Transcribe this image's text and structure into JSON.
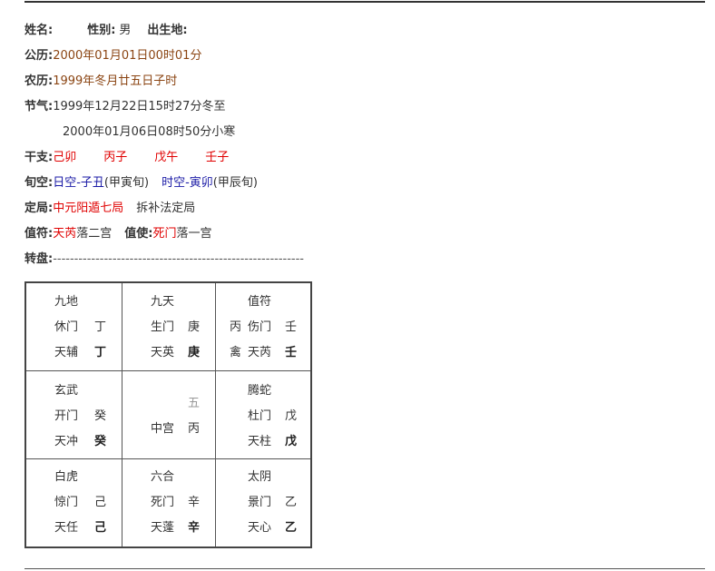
{
  "header": {
    "name_label": "姓名:",
    "gender_label": "性别:",
    "gender_value": "男",
    "birthplace_label": "出生地:"
  },
  "solar": {
    "label": "公历:",
    "value": "2000年01月01日00时01分"
  },
  "lunar": {
    "label": "农历:",
    "value": "1999年冬月廿五日子时"
  },
  "solar_terms": {
    "label": "节气:",
    "items": [
      "1999年12月22日15时27分冬至",
      "2000年01月06日08时50分小寒"
    ]
  },
  "ganzhi": {
    "label": "干支:",
    "items": [
      "己卯",
      "丙子",
      "戊午",
      "壬子"
    ]
  },
  "xunkong": {
    "label": "旬空:",
    "day_void": "日空-子丑",
    "day_xun": "(甲寅旬)",
    "hour_void": "时空-寅卯",
    "hour_xun": "(甲辰旬)"
  },
  "ju": {
    "label": "定局:",
    "value": "中元阳遁七局",
    "method": "拆补法定局"
  },
  "zhifu": {
    "label": "值符:",
    "star": "天芮",
    "star_palace": "落二宫",
    "shi_label": "值使:",
    "door": "死门",
    "door_palace": "落一宫"
  },
  "zhuanpan": {
    "label": "转盘:",
    "rule": "-----------------------------------------------------------"
  },
  "palaces": [
    {
      "god": "九地",
      "door": "休门",
      "sky_stem": "丁",
      "star": "天辅",
      "earth_stem": "丁"
    },
    {
      "god": "九天",
      "door": "生门",
      "sky_stem": "庚",
      "star": "天英",
      "earth_stem": "庚"
    },
    {
      "god": "值符",
      "hidden_left_door": "丙",
      "door": "伤门",
      "sky_stem": "壬",
      "hidden_left_star": "禽",
      "star": "天芮",
      "earth_stem": "壬"
    },
    {
      "god": "玄武",
      "door": "开门",
      "sky_stem": "癸",
      "star": "天冲",
      "earth_stem": "癸"
    },
    {
      "center_num": "五",
      "center_label": "中宫",
      "center_stem": "丙"
    },
    {
      "god": "腾蛇",
      "door": "杜门",
      "sky_stem": "戊",
      "star": "天柱",
      "earth_stem": "戊"
    },
    {
      "god": "白虎",
      "door": "惊门",
      "sky_stem": "己",
      "star": "天任",
      "earth_stem": "己"
    },
    {
      "god": "六合",
      "door": "死门",
      "sky_stem": "辛",
      "star": "天蓬",
      "earth_stem": "辛"
    },
    {
      "god": "太阴",
      "door": "景门",
      "sky_stem": "乙",
      "star": "天心",
      "earth_stem": "乙"
    }
  ],
  "colors": {
    "solar": "#8b4513",
    "ganzhi": "#e00000",
    "void": "#1a1aa6",
    "border": "#444444"
  }
}
